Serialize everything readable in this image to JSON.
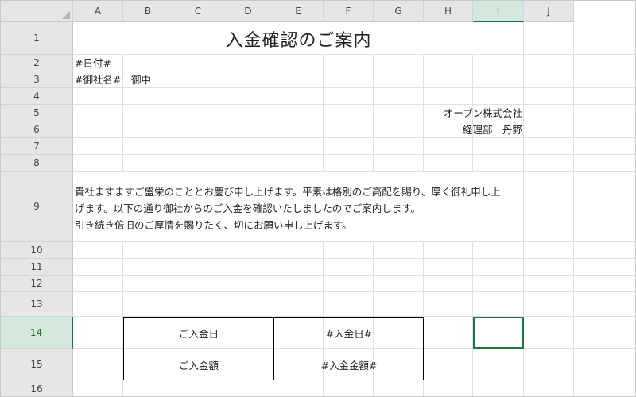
{
  "columns": [
    "A",
    "B",
    "C",
    "D",
    "E",
    "F",
    "G",
    "H",
    "I",
    "J"
  ],
  "rows": [
    "1",
    "2",
    "3",
    "4",
    "5",
    "6",
    "7",
    "8",
    "9",
    "10",
    "11",
    "12",
    "13",
    "14",
    "15",
    "16"
  ],
  "selected": {
    "column": "I",
    "row": "14"
  },
  "doc": {
    "title": "入金確認のご案内",
    "date_placeholder": "#日付#",
    "recipient": "#御社名#　御中",
    "company": "オープン株式会社",
    "department": "経理部　丹野",
    "body_lines": [
      "貴社ますますご盛栄のこととお慶び申し上げます。平素は格別のご高配を賜り、厚く御礼申し上",
      "げます。以下の通り御社からのご入金を確認いたしましたのでご案内します。",
      "引き続き倍旧のご厚情を賜りたく、切にお願い申し上げます。"
    ],
    "table": [
      {
        "label": "ご入金日",
        "value": "#入金日#"
      },
      {
        "label": "ご入金額",
        "value": "#入金金額#"
      }
    ]
  }
}
